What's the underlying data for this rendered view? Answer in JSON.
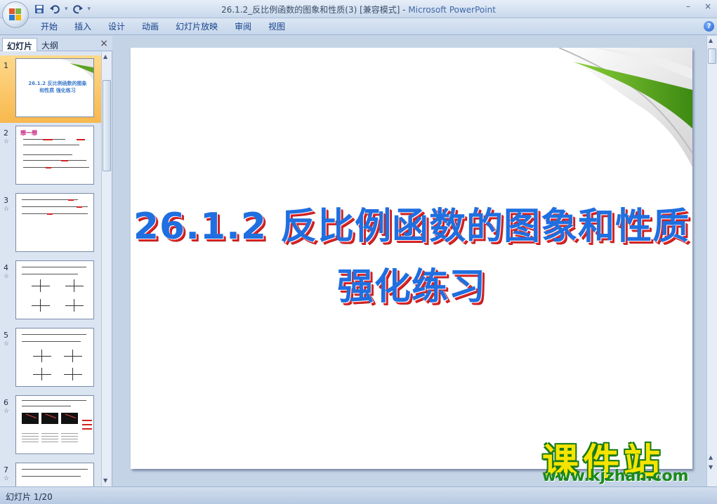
{
  "window": {
    "title_doc": "26.1.2_反比例函数的图象和性质(3) [兼容模式] - ",
    "title_app": "Microsoft PowerPoint",
    "minimize": "–",
    "close": "×"
  },
  "qat": {
    "dropdown": "▾"
  },
  "ribbon": {
    "tabs": [
      "开始",
      "插入",
      "设计",
      "动画",
      "幻灯片放映",
      "审阅",
      "视图"
    ],
    "help": "?"
  },
  "pane": {
    "tab_slides": "幻灯片",
    "tab_outline": "大纲",
    "close": "×"
  },
  "thumbnails": [
    {
      "num": "1",
      "title": "26.1.2 反比例函数的图象和性质 强化练习"
    },
    {
      "num": "2",
      "head": "想一想"
    },
    {
      "num": "3"
    },
    {
      "num": "4"
    },
    {
      "num": "5"
    },
    {
      "num": "6"
    },
    {
      "num": "7"
    }
  ],
  "slide": {
    "title_line1": "26.1.2 反比例函数的图象和性质",
    "title_line2": "强化练习"
  },
  "watermark": {
    "name": "课件站",
    "url": "www.kjzhan.com"
  },
  "status": {
    "slide_counter": "幻灯片 1/20"
  },
  "colors": {
    "title_fill": "#1f6fe0",
    "title_shadow": "#e02424",
    "selected_thumb": "#f7b84e",
    "leaf_green": "#5da31f"
  }
}
